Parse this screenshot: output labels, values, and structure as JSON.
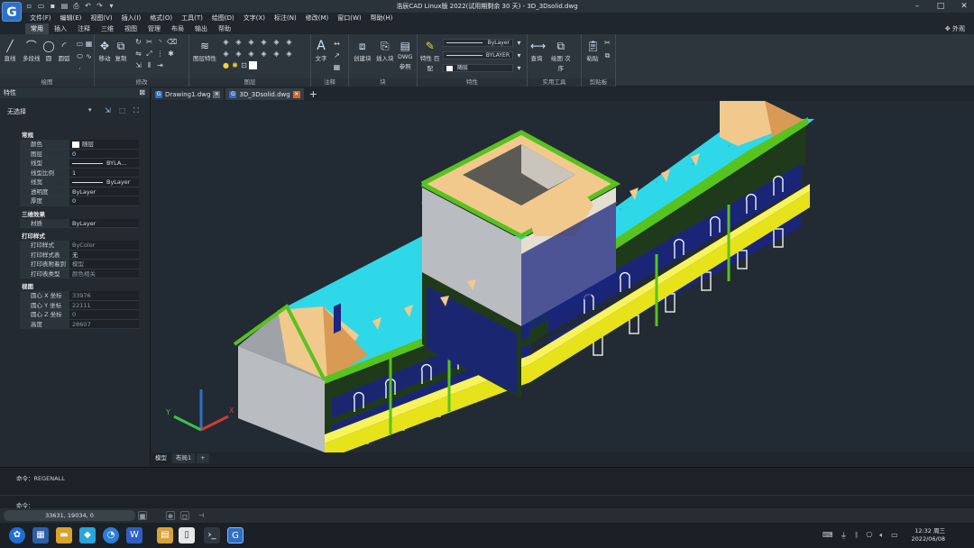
{
  "window": {
    "title": "浩辰CAD Linux版 2022(试用期剩余 30 天) - 3D_3Dsolid.dwg",
    "logo_letter": "G"
  },
  "menu": [
    "文件(F)",
    "编辑(E)",
    "视图(V)",
    "插入(I)",
    "格式(O)",
    "工具(T)",
    "绘图(D)",
    "文字(X)",
    "标注(N)",
    "修改(M)",
    "窗口(W)",
    "帮助(H)"
  ],
  "ribbon_tabs": [
    "常用",
    "插入",
    "注释",
    "三维",
    "视图",
    "管理",
    "布局",
    "输出",
    "帮助"
  ],
  "appearance_label": "外观",
  "ribbon": {
    "groups": {
      "draw": "绘图",
      "modify": "修改",
      "layer": "图层",
      "annotation": "注释",
      "block": "块",
      "properties": "特性",
      "utilities": "实用工具",
      "clipboard": "剪贴板"
    },
    "tools": {
      "line": "直线",
      "polyline": "多段线",
      "circle": "圆",
      "arc": "圆弧",
      "move": "移动",
      "copy": "复制",
      "layer_props": "图层特性",
      "text": "文字",
      "create_block": "创建块",
      "insert_block": "插入块",
      "dwg_ref_1": "DWG",
      "dwg_ref_2": "参照",
      "match_props_1": "特性 匹",
      "match_props_2": "配",
      "query": "查询",
      "draw_order_1": "绘图 次",
      "draw_order_2": "序",
      "paste": "粘贴"
    },
    "bylayer_color": "ByLayer",
    "bylayer_linetype": "BYLAYER",
    "layer_current": "随层",
    "lineweight_current": "随层"
  },
  "properties_panel": {
    "title": "特性",
    "selection": "无选择",
    "sections": [
      {
        "name": "常规",
        "rows": [
          {
            "k": "颜色",
            "v": "随层",
            "swatch": true
          },
          {
            "k": "图层",
            "v": "0"
          },
          {
            "k": "线型",
            "v": "BYLA…",
            "line": true
          },
          {
            "k": "线型比例",
            "v": "1"
          },
          {
            "k": "线宽",
            "v": "ByLayer",
            "line": true
          },
          {
            "k": "透明度",
            "v": "ByLayer"
          },
          {
            "k": "厚度",
            "v": "0"
          }
        ]
      },
      {
        "name": "三维效果",
        "rows": [
          {
            "k": "材质",
            "v": "ByLayer"
          }
        ]
      },
      {
        "name": "打印样式",
        "rows": [
          {
            "k": "打印样式",
            "v": "ByColor"
          },
          {
            "k": "打印样式表",
            "v": "无"
          },
          {
            "k": "打印表附着到",
            "v": "模型"
          },
          {
            "k": "打印表类型",
            "v": "颜色相关"
          }
        ]
      },
      {
        "name": "视图",
        "rows": [
          {
            "k": "圆心 X 坐标",
            "v": "33976"
          },
          {
            "k": "圆心 Y 坐标",
            "v": "22111"
          },
          {
            "k": "圆心 Z 坐标",
            "v": "0"
          },
          {
            "k": "高度",
            "v": "28607"
          }
        ]
      }
    ]
  },
  "doc_tabs": [
    {
      "label": "Drawing1.dwg",
      "active": false
    },
    {
      "label": "3D_3Dsolid.dwg",
      "active": true
    }
  ],
  "layout_tabs": [
    "模型",
    "布局1",
    "+"
  ],
  "ucs": {
    "x": "X",
    "y": "Y"
  },
  "command": {
    "history_prefix": "命令：",
    "history_value": "REGENALL",
    "prompt": "命令："
  },
  "status": {
    "coords": "33631, 19034, 0"
  },
  "taskbar": {
    "time": "12:32 周三",
    "date": "2022/06/08"
  },
  "colors": {
    "roof": "#2fd8e8",
    "trim_green": "#58c21e",
    "base_yellow": "#e6e31a",
    "gable": "#f2c98c",
    "window_blue": "#1a2580",
    "wall_gray": "#b9bcc0",
    "accent_blue": "#2f6fc4"
  }
}
